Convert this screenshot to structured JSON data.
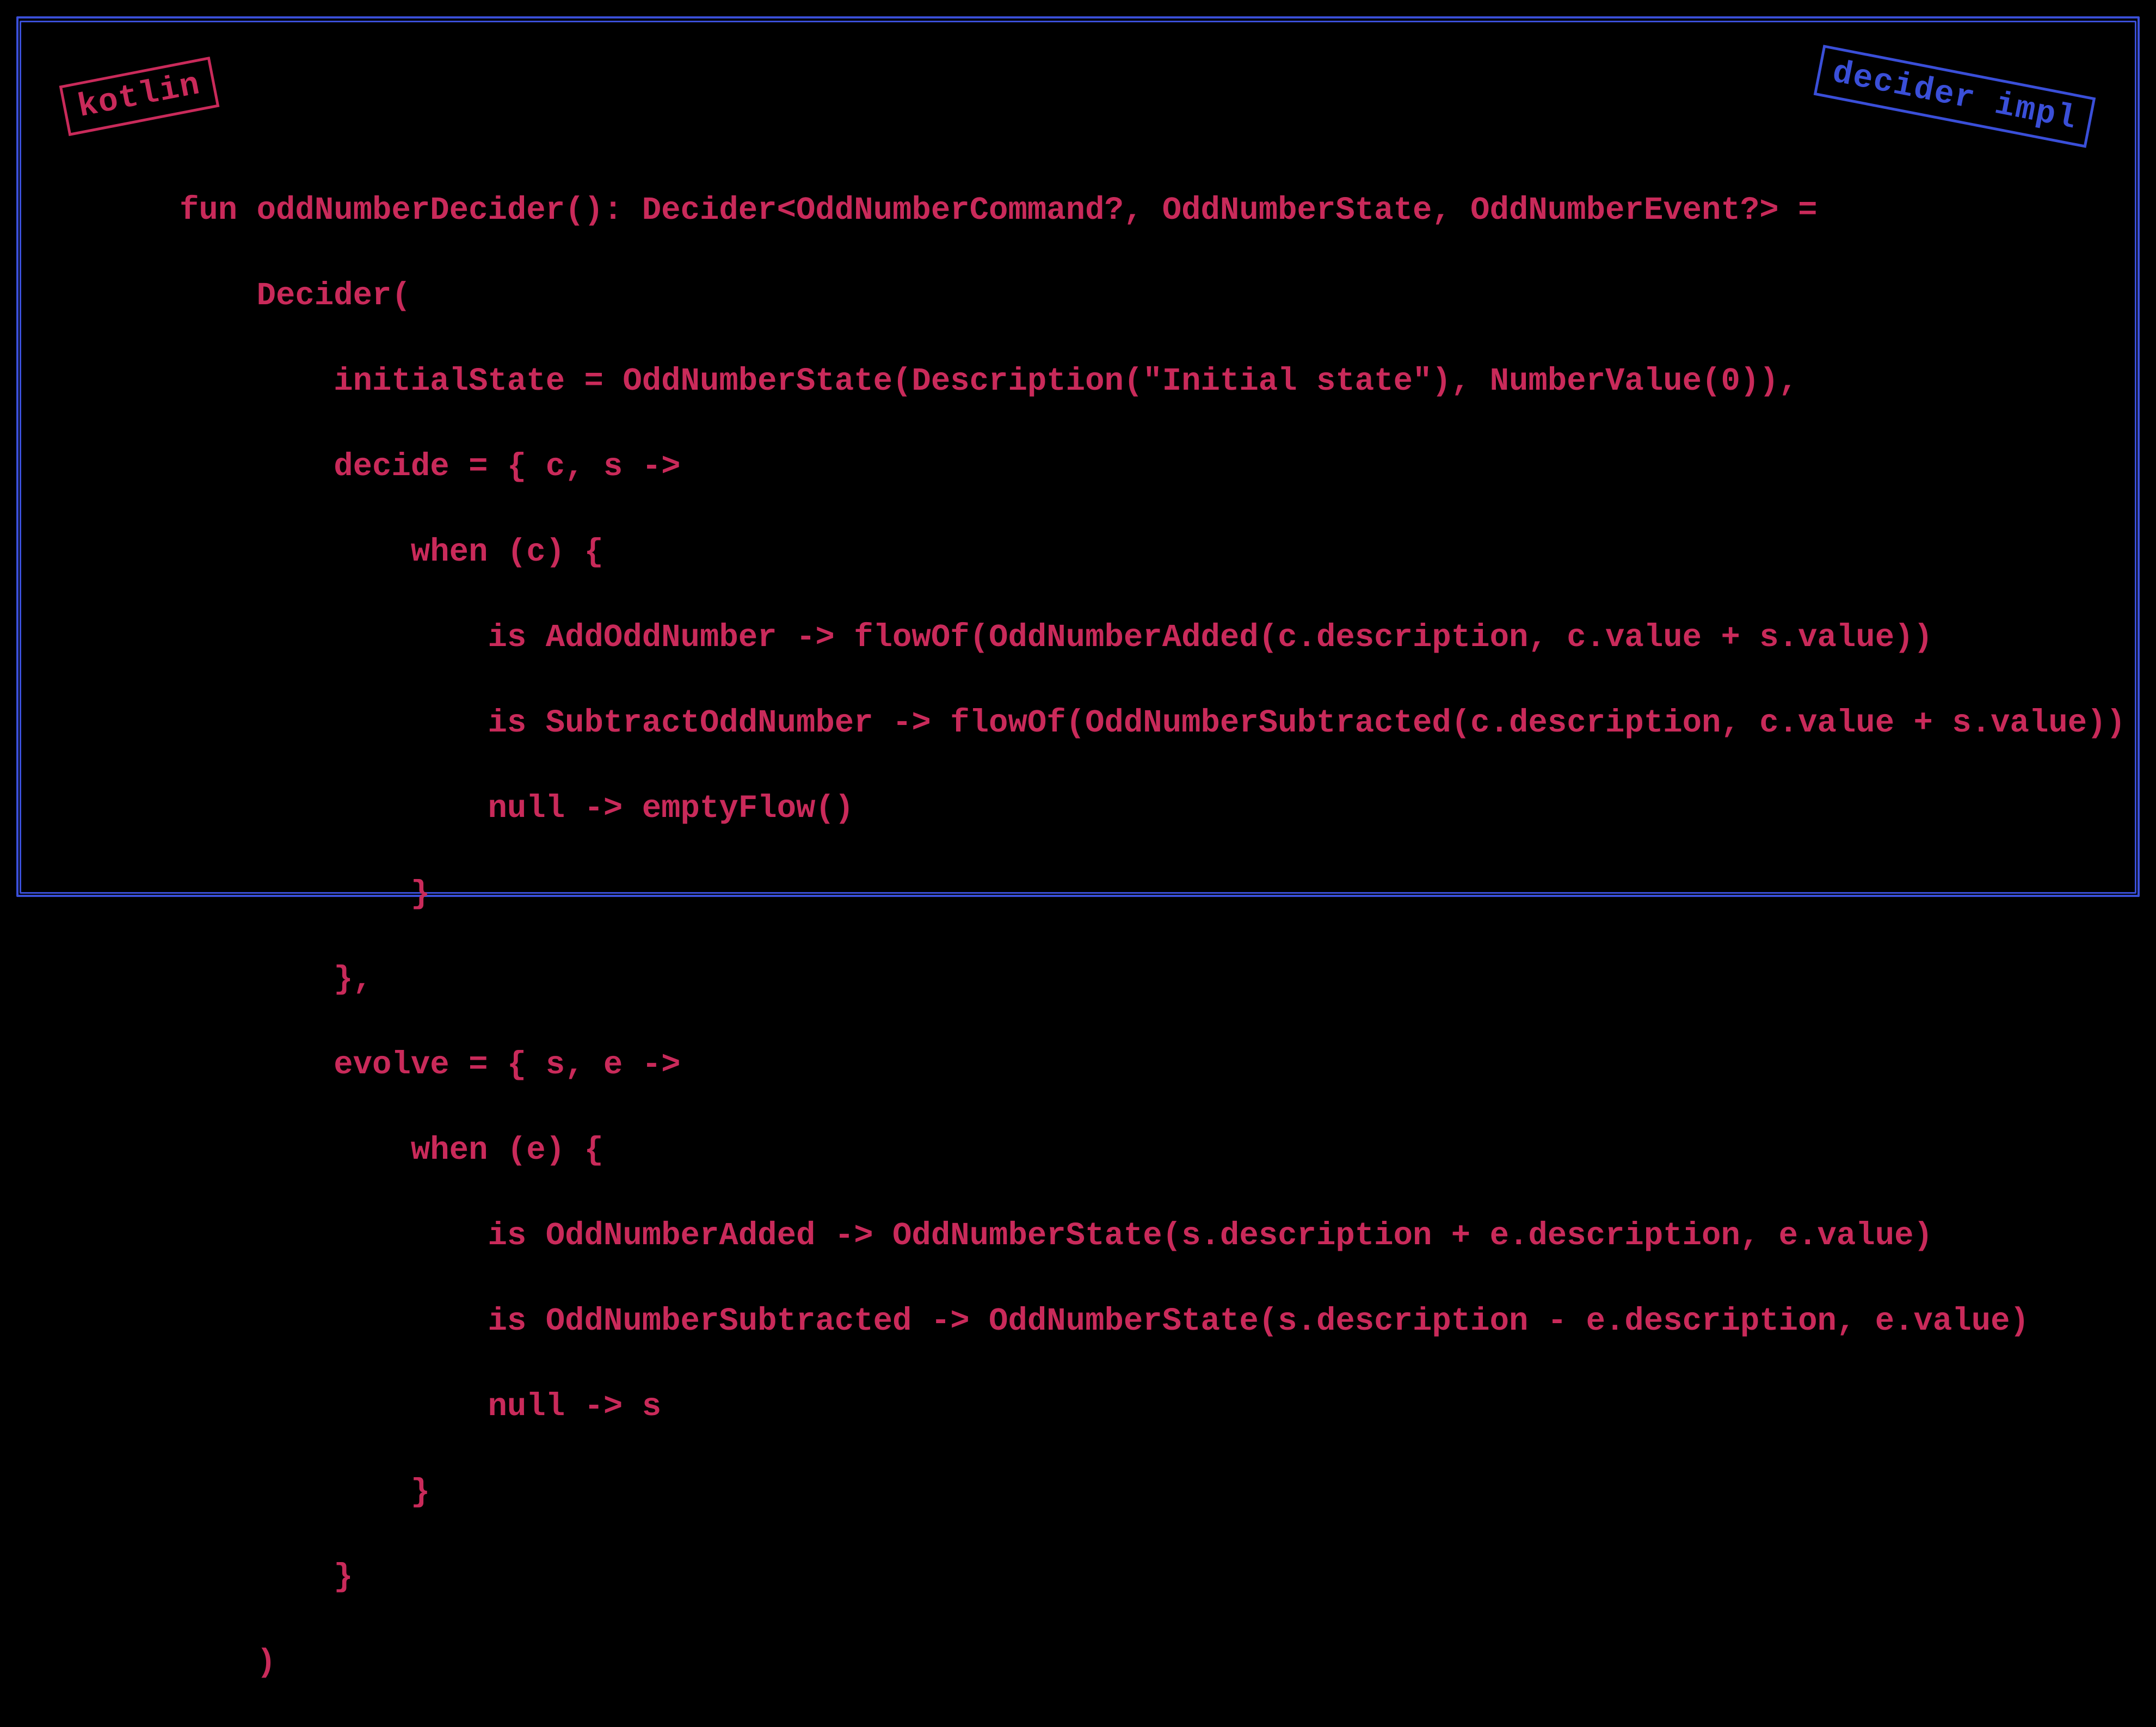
{
  "badges": {
    "left": "kotlin",
    "right": "decider impl"
  },
  "code": {
    "l1": "fun oddNumberDecider(): Decider<OddNumberCommand?, OddNumberState, OddNumberEvent?> =",
    "l2": "    Decider(",
    "l3": "        initialState = OddNumberState(Description(\"Initial state\"), NumberValue(0)),",
    "l4": "        decide = { c, s ->",
    "l5": "            when (c) {",
    "l6": "                is AddOddNumber -> flowOf(OddNumberAdded(c.description, c.value + s.value))",
    "l7": "                is SubtractOddNumber -> flowOf(OddNumberSubtracted(c.description, c.value + s.value))",
    "l8": "                null -> emptyFlow()",
    "l9": "            }",
    "l10": "        },",
    "l11": "        evolve = { s, e ->",
    "l12": "            when (e) {",
    "l13": "                is OddNumberAdded -> OddNumberState(s.description + e.description, e.value)",
    "l14": "                is OddNumberSubtracted -> OddNumberState(s.description - e.description, e.value)",
    "l15": "                null -> s",
    "l16": "            }",
    "l17": "        }",
    "l18": "    )"
  }
}
